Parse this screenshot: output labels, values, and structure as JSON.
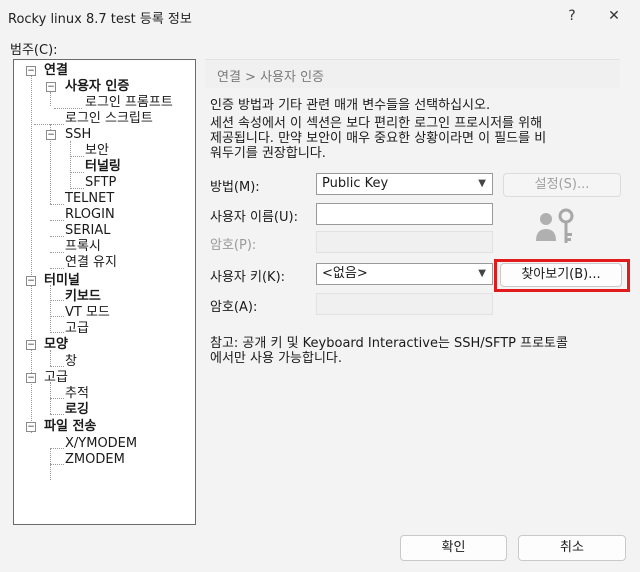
{
  "window": {
    "title": "Rocky linux 8.7 test 등록 정보",
    "help": "?",
    "close": "✕"
  },
  "category_label": "범주(C):",
  "tree": [
    {
      "label": "연결",
      "bold": true
    },
    {
      "label": "사용자 인증",
      "bold": true
    },
    {
      "label": "로그인 프롬프트",
      "bold": false
    },
    {
      "label": "로그인 스크립트",
      "bold": false
    },
    {
      "label": "SSH",
      "bold": false
    },
    {
      "label": "보안",
      "bold": false
    },
    {
      "label": "터널링",
      "bold": true
    },
    {
      "label": "SFTP",
      "bold": false
    },
    {
      "label": "TELNET",
      "bold": false
    },
    {
      "label": "RLOGIN",
      "bold": false
    },
    {
      "label": "SERIAL",
      "bold": false
    },
    {
      "label": "프록시",
      "bold": false
    },
    {
      "label": "연결 유지",
      "bold": false
    },
    {
      "label": "터미널",
      "bold": true
    },
    {
      "label": "키보드",
      "bold": true
    },
    {
      "label": "VT 모드",
      "bold": false
    },
    {
      "label": "고급",
      "bold": false
    },
    {
      "label": "모양",
      "bold": true
    },
    {
      "label": "창",
      "bold": false
    },
    {
      "label": "고급",
      "bold": false
    },
    {
      "label": "추적",
      "bold": false
    },
    {
      "label": "로깅",
      "bold": true
    },
    {
      "label": "파일 전송",
      "bold": true
    },
    {
      "label": "X/YMODEM",
      "bold": false
    },
    {
      "label": "ZMODEM",
      "bold": false
    }
  ],
  "panel": {
    "breadcrumb": "연결 > 사용자 인증",
    "intro": "인증 방법과 기타 관련 매개 변수들을 선택하십시오.",
    "warning": "세션 속성에서 이 섹션은 보다 편리한 로그인 프로시저를 위해\n제공됩니다. 만약 보안이 매우 중요한 상황이라면 이 필드를 비\n워두기를 권장합니다.",
    "method_label": "방법(M):",
    "method_value": "Public Key",
    "settings_button": "설정(S)...",
    "username_label": "사용자 이름(U):",
    "username_value": "",
    "password_label": "암호(P):",
    "userkey_label": "사용자 키(K):",
    "userkey_value": "<없음>",
    "browse_button": "찾아보기(B)...",
    "passphrase_label": "암호(A):",
    "note": "참고: 공개 키 및 Keyboard Interactive는 SSH/SFTP 프로토콜\n에서만 사용 가능합니다."
  },
  "footer": {
    "ok": "확인",
    "cancel": "취소"
  },
  "colors": {
    "highlight": "#e11b1b",
    "background": "#f3f3f3"
  },
  "icons": {
    "help": "help-icon",
    "close": "close-icon",
    "key": "user-key-icon"
  }
}
